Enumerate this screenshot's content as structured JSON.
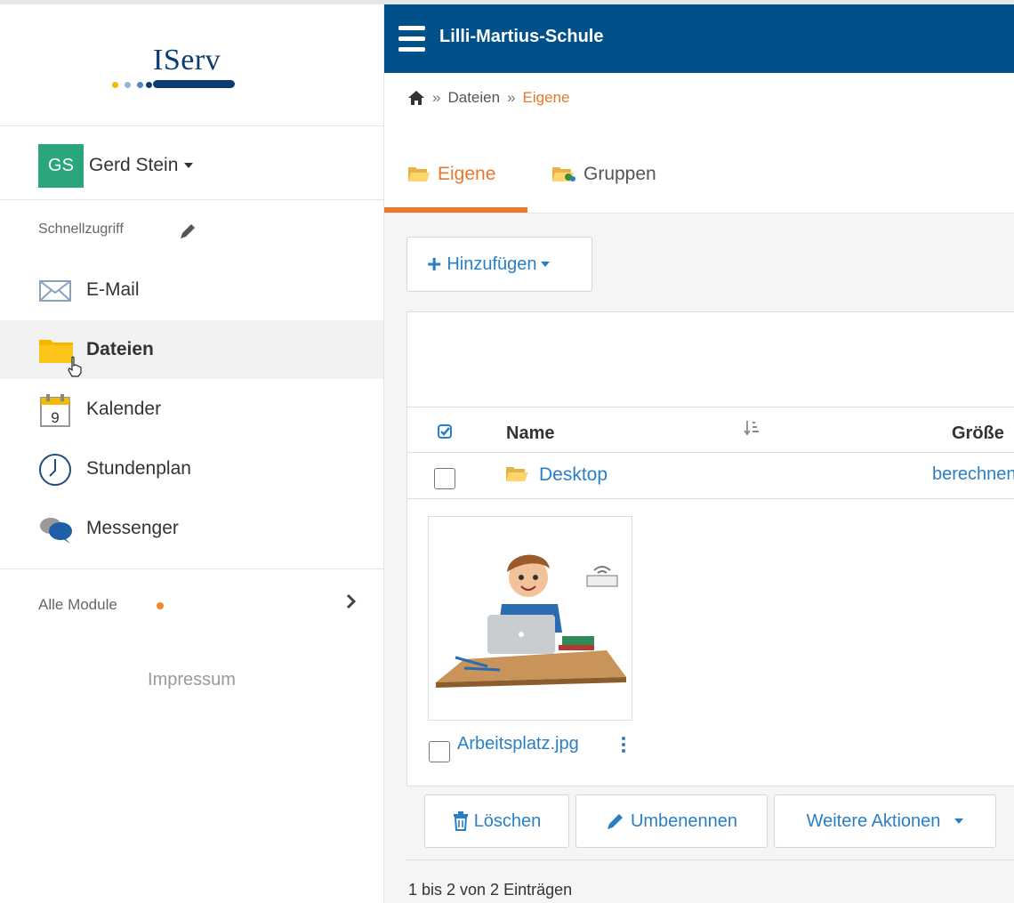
{
  "sidebar": {
    "logo_text": "IServ",
    "user": {
      "initials": "GS",
      "name": "Gerd Stein"
    },
    "quick_access_label": "Schnellzugriff",
    "items": [
      {
        "label": "E-Mail",
        "icon": "envelope-icon"
      },
      {
        "label": "Dateien",
        "icon": "folder-icon",
        "active": true
      },
      {
        "label": "Kalender",
        "icon": "calendar-icon",
        "calendar_day": "9"
      },
      {
        "label": "Stundenplan",
        "icon": "clock-icon"
      },
      {
        "label": "Messenger",
        "icon": "chat-bubbles-icon"
      }
    ],
    "all_modules_label": "Alle Module",
    "impressum_label": "Impressum"
  },
  "header": {
    "title": "Lilli-Martius-Schule"
  },
  "breadcrumb": {
    "home_icon": "home-icon",
    "sep": "»",
    "items": [
      "Dateien",
      "Eigene"
    ]
  },
  "tabs": [
    {
      "label": "Eigene",
      "active": true
    },
    {
      "label": "Gruppen",
      "active": false
    }
  ],
  "toolbar": {
    "add_label": "Hinzufügen"
  },
  "table": {
    "columns": {
      "name": "Name",
      "size": "Größe"
    },
    "rows": [
      {
        "name": "Desktop",
        "size": "berechnen"
      }
    ]
  },
  "thumbnail": {
    "file_name": "Arbeitsplatz.jpg"
  },
  "actions": {
    "delete": "Löschen",
    "rename": "Umbenennen",
    "more": "Weitere Aktionen"
  },
  "footer": {
    "count_text": "1 bis 2 von 2 Einträgen"
  },
  "colors": {
    "brand_blue": "#00508a",
    "accent_orange": "#e8782c",
    "link_blue": "#2a7fc4",
    "avatar_green": "#2aa57e"
  }
}
